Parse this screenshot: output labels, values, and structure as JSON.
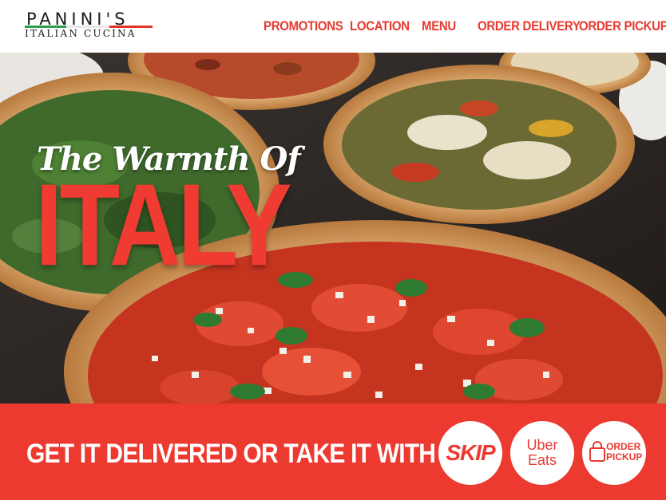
{
  "logo": {
    "title": "PANINI'S",
    "subtitle": "ITALIAN CUCINA",
    "stripe_colors": [
      "#2f9e4f",
      "#e8e8e8",
      "#e5322d"
    ]
  },
  "nav": {
    "items": [
      {
        "label": "PROMOTIONS"
      },
      {
        "label": "LOCATION"
      },
      {
        "label": "MENU"
      },
      {
        "label": "ORDER DELIVERY"
      },
      {
        "label": "ORDER PICKUP"
      }
    ],
    "color": "#e53a30"
  },
  "hero": {
    "tagline": "The Warmth Of",
    "headline": "ITALY"
  },
  "banner": {
    "text": "GET IT DELIVERED OR TAKE IT WITH YOU",
    "background": "#ec3a31",
    "buttons": {
      "skip": {
        "label": "SKIP"
      },
      "uber": {
        "line1": "Uber",
        "line2": "Eats"
      },
      "pickup": {
        "line1": "ORDER",
        "line2": "PICKUP",
        "icon": "shopping-bag-icon"
      }
    }
  }
}
